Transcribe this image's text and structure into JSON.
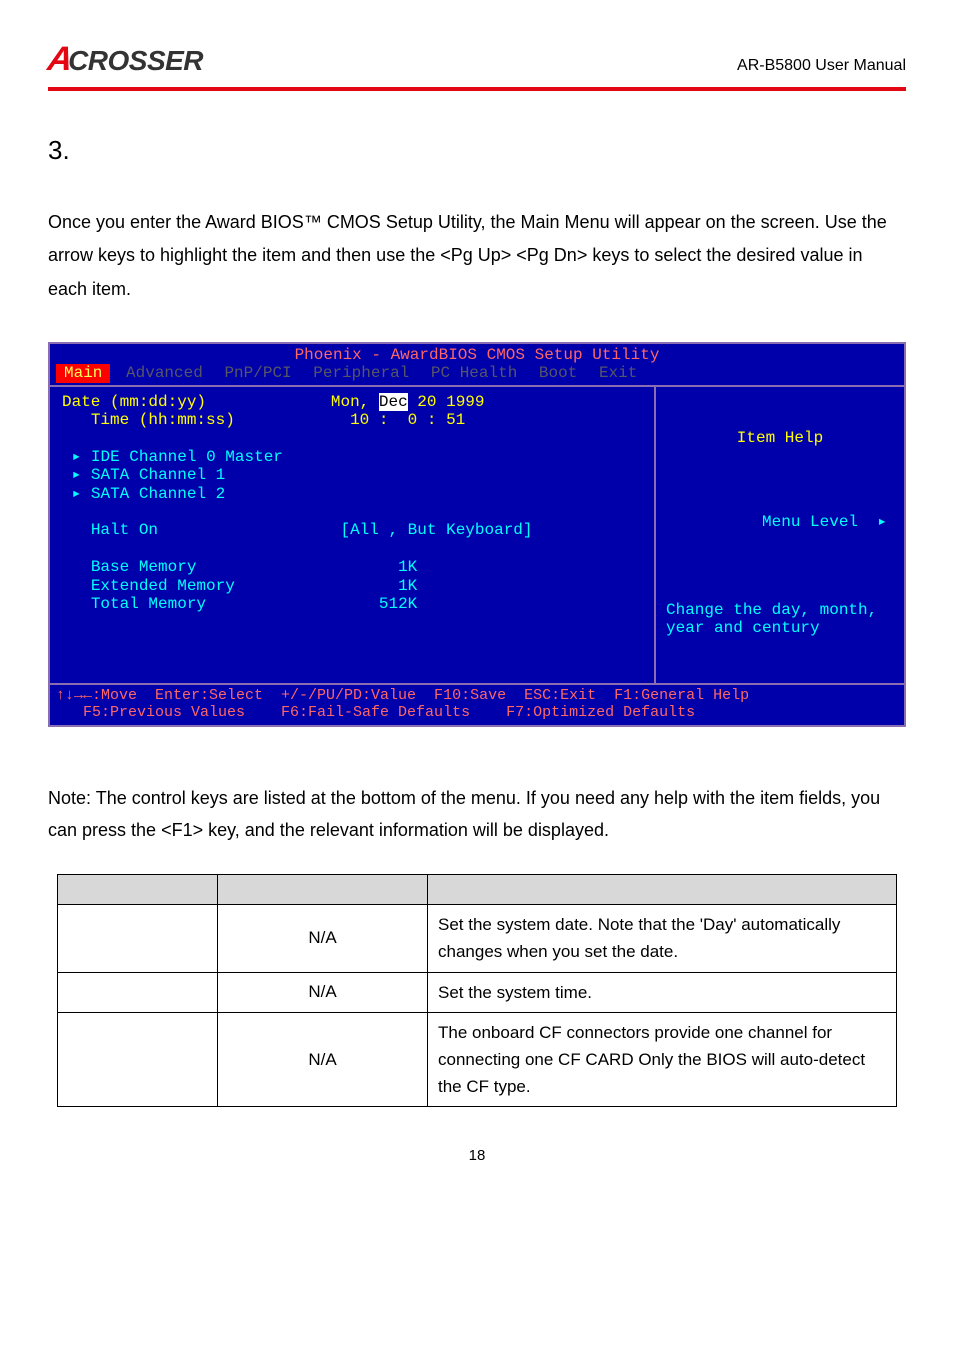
{
  "header": {
    "logo_text": "CROSSER",
    "doc_title": "AR-B5800 User Manual"
  },
  "section_number": "3.",
  "intro_paragraph": "Once you enter the Award BIOS™ CMOS Setup Utility, the Main Menu will appear on the screen. Use the arrow keys to highlight the item and then use the <Pg Up> <Pg Dn> keys to select the desired value in each item.",
  "bios": {
    "title": "Phoenix - AwardBIOS CMOS Setup Utility",
    "tabs": [
      "Main",
      "Advanced",
      "PnP/PCI",
      "Peripheral",
      "PC Health",
      "Boot",
      "Exit"
    ],
    "active_tab": "Main",
    "fields": {
      "date_label": "Date (mm:dd:yy)",
      "date_value_pre": "Mon, ",
      "date_value_sel": "Dec",
      "date_value_post": " 20 1999",
      "time_label": "Time (hh:mm:ss)",
      "time_value": "10 :  0 : 51",
      "ide_label": "IDE Channel 0 Master",
      "sata1_label": "SATA Channel 1",
      "sata2_label": "SATA Channel 2",
      "halt_label": "Halt On",
      "halt_value": "[All , But Keyboard]",
      "base_mem_label": "Base Memory",
      "base_mem_value": "1K",
      "ext_mem_label": "Extended Memory",
      "ext_mem_value": "1K",
      "total_mem_label": "Total Memory",
      "total_mem_value": "512K"
    },
    "help": {
      "title": "Item Help",
      "menu_level_label": "Menu Level",
      "menu_level_arrow": "▸",
      "text": "Change the day, month, year and century"
    },
    "footer_line1": "↑↓→←:Move  Enter:Select  +/-/PU/PD:Value  F10:Save  ESC:Exit  F1:General Help",
    "footer_line2": "   F5:Previous Values    F6:Fail-Safe Defaults    F7:Optimized Defaults"
  },
  "note": "Note: The control keys are listed at the bottom of the menu. If you need any help with the item fields, you can press the <F1> key, and the relevant information will be displayed.",
  "table": {
    "rows": [
      {
        "c1": "",
        "c2": "N/A",
        "c3": "Set the system date. Note that the 'Day' automatically changes when you set the date."
      },
      {
        "c1": "",
        "c2": "N/A",
        "c3": "Set the system time."
      },
      {
        "c1": "",
        "c2": "N/A",
        "c3": "The onboard CF connectors provide one channel for connecting one CF CARD Only the BIOS will auto-detect the CF type."
      }
    ]
  },
  "page_number": "18"
}
